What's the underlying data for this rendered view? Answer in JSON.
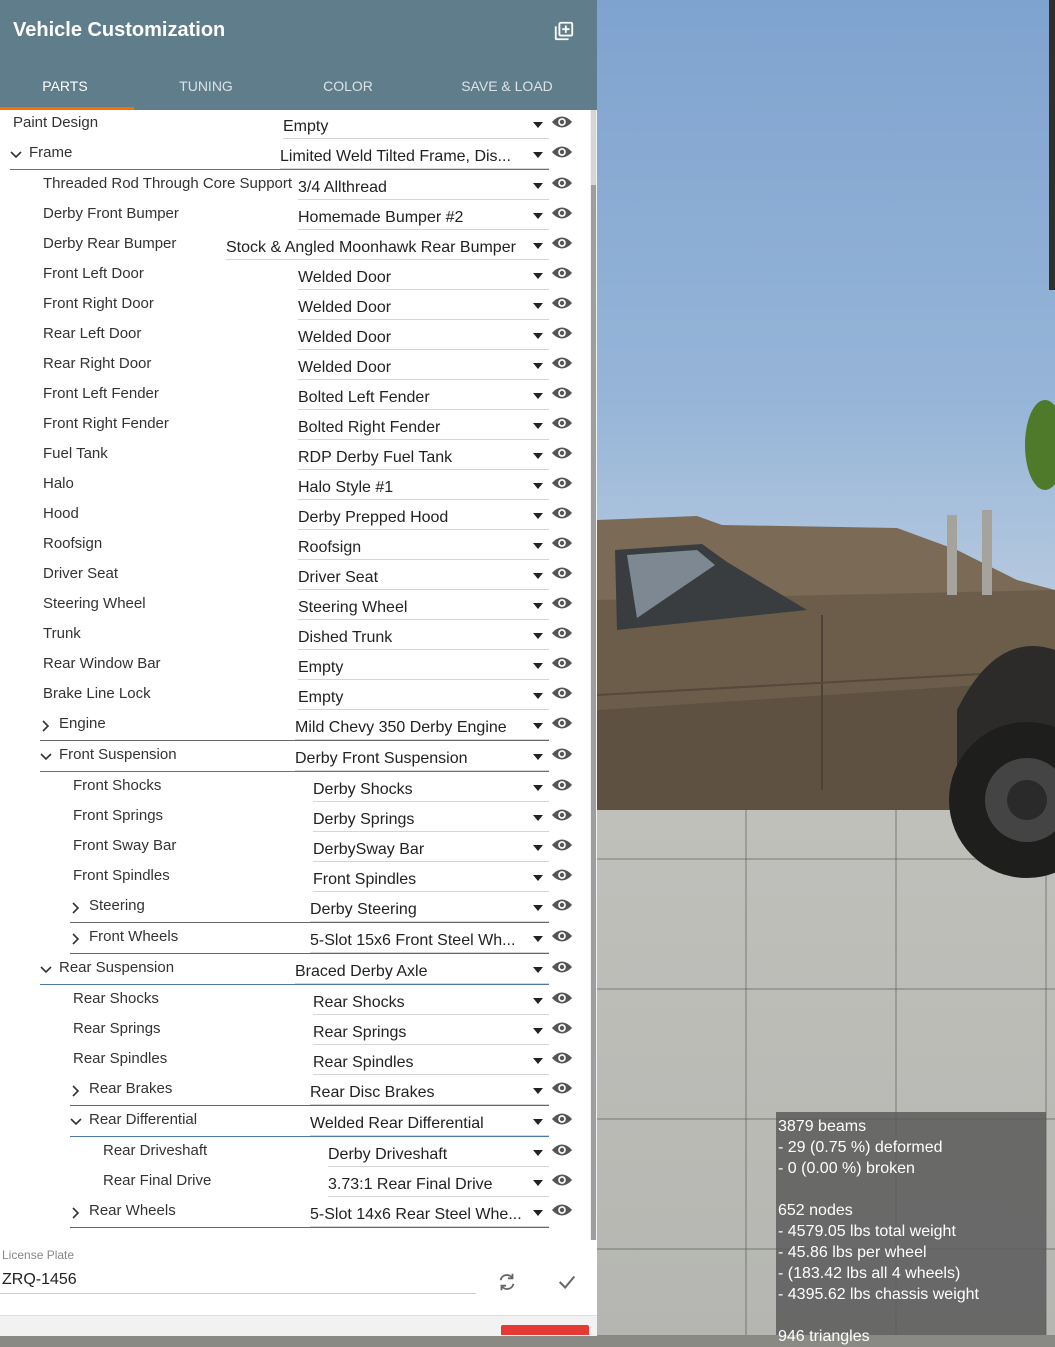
{
  "header": {
    "title": "Vehicle Customization"
  },
  "tabs": [
    {
      "label": "PARTS",
      "active": true
    },
    {
      "label": "TUNING",
      "active": false
    },
    {
      "label": "COLOR",
      "active": false
    },
    {
      "label": "SAVE & LOAD",
      "active": false
    }
  ],
  "parts": [
    {
      "label": "Paint Design",
      "value": "Empty",
      "depth": 0
    },
    {
      "label": "Frame",
      "value": "Limited Weld Tilted Frame, Dis...",
      "depth": 0,
      "expander": "open"
    },
    {
      "label": "Threaded Rod Through Core Support",
      "value": "3/4 Allthread",
      "depth": 1
    },
    {
      "label": "Derby Front Bumper",
      "value": "Homemade Bumper #2",
      "depth": 1
    },
    {
      "label": "Derby Rear Bumper",
      "value": "Stock & Angled Moonhawk Rear Bumper",
      "depth": 1
    },
    {
      "label": "Front Left Door",
      "value": "Welded Door",
      "depth": 1
    },
    {
      "label": "Front Right Door",
      "value": "Welded Door",
      "depth": 1
    },
    {
      "label": "Rear Left Door",
      "value": "Welded Door",
      "depth": 1
    },
    {
      "label": "Rear Right Door",
      "value": "Welded Door",
      "depth": 1
    },
    {
      "label": "Front Left Fender",
      "value": "Bolted Left Fender",
      "depth": 1
    },
    {
      "label": "Front Right Fender",
      "value": "Bolted Right Fender",
      "depth": 1
    },
    {
      "label": "Fuel Tank",
      "value": "RDP Derby Fuel Tank",
      "depth": 1
    },
    {
      "label": "Halo",
      "value": "Halo Style #1",
      "depth": 1
    },
    {
      "label": "Hood",
      "value": "Derby Prepped Hood",
      "depth": 1
    },
    {
      "label": "Roofsign",
      "value": "Roofsign",
      "depth": 1
    },
    {
      "label": "Driver Seat",
      "value": "Driver Seat",
      "depth": 1
    },
    {
      "label": "Steering Wheel",
      "value": "Steering Wheel",
      "depth": 1
    },
    {
      "label": "Trunk",
      "value": "Dished Trunk",
      "depth": 1
    },
    {
      "label": "Rear Window Bar",
      "value": "Empty",
      "depth": 1
    },
    {
      "label": "Brake Line Lock",
      "value": "Empty",
      "depth": 1
    },
    {
      "label": "Engine",
      "value": "Mild Chevy 350 Derby Engine",
      "depth": 1,
      "expander": "closed"
    },
    {
      "label": "Front Suspension",
      "value": "Derby Front Suspension",
      "depth": 1,
      "expander": "open"
    },
    {
      "label": "Front Shocks",
      "value": "Derby Shocks",
      "depth": 2
    },
    {
      "label": "Front Springs",
      "value": "Derby Springs",
      "depth": 2
    },
    {
      "label": "Front Sway Bar",
      "value": "DerbySway Bar",
      "depth": 2
    },
    {
      "label": "Front Spindles",
      "value": "Front Spindles",
      "depth": 2
    },
    {
      "label": "Steering",
      "value": "Derby Steering",
      "depth": 2,
      "expander": "closed"
    },
    {
      "label": "Front Wheels",
      "value": "5-Slot 15x6 Front Steel Wh...",
      "depth": 2,
      "expander": "closed"
    },
    {
      "label": "Rear Suspension",
      "value": "Braced Derby Axle",
      "depth": 1,
      "expander": "open"
    },
    {
      "label": "Rear Shocks",
      "value": "Rear Shocks",
      "depth": 2
    },
    {
      "label": "Rear Springs",
      "value": "Rear Springs",
      "depth": 2
    },
    {
      "label": "Rear Spindles",
      "value": "Rear Spindles",
      "depth": 2
    },
    {
      "label": "Rear Brakes",
      "value": "Rear Disc Brakes",
      "depth": 2,
      "expander": "closed"
    },
    {
      "label": "Rear Differential",
      "value": "Welded Rear Differential",
      "depth": 2,
      "expander": "open"
    },
    {
      "label": "Rear Driveshaft",
      "value": "Derby Driveshaft",
      "depth": 3
    },
    {
      "label": "Rear Final Drive",
      "value": "3.73:1 Rear Final Drive",
      "depth": 3
    },
    {
      "label": "Rear Wheels",
      "value": "5-Slot 14x6 Rear Steel Whe...",
      "depth": 2,
      "expander": "closed"
    }
  ],
  "license_plate": {
    "label": "License Plate",
    "value": "ZRQ-1456"
  },
  "stats": {
    "text": "3879 beams\n- 29 (0.75 %) deformed\n- 0 (0.00 %) broken\n\n652 nodes\n- 4579.05 lbs total weight\n- 45.86 lbs per wheel\n- (183.42 lbs all 4 wheels)\n- 4395.62 lbs chassis weight\n\n946 triangles"
  },
  "colors": {
    "header": "#607d8b",
    "accent": "#ff6d00",
    "tree_line": "#4a76a8"
  },
  "icons": {
    "header_action": "add-box-icon",
    "visibility": "eye-icon",
    "refresh": "refresh-icon",
    "apply": "check-icon"
  }
}
